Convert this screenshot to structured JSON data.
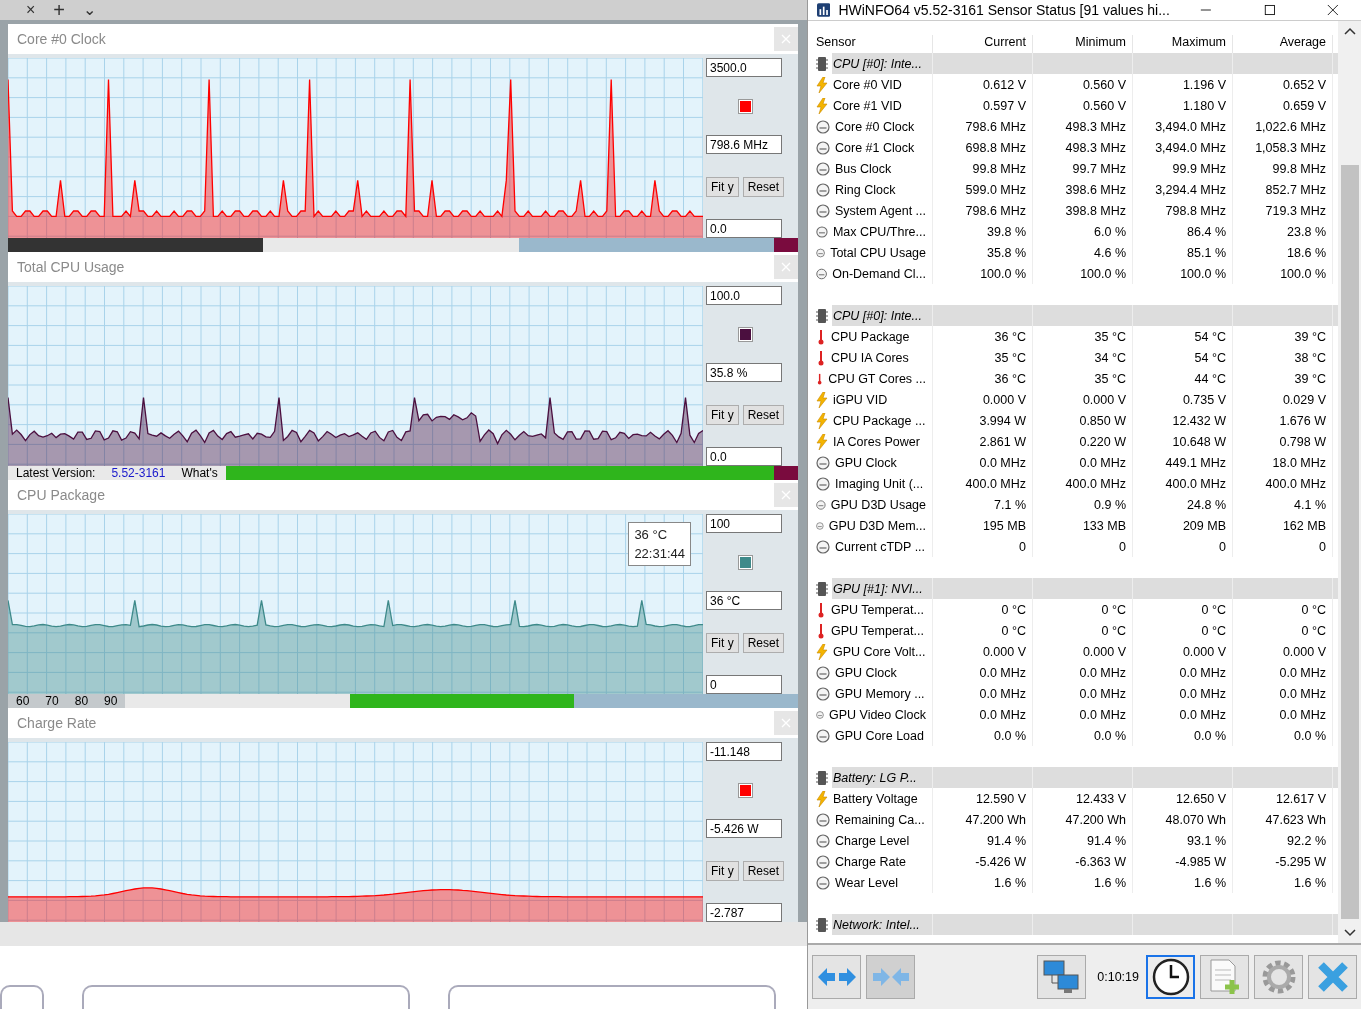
{
  "browser_tabs": {
    "close": "×",
    "new": "+",
    "more": "⌄"
  },
  "graphs": [
    {
      "title": "Core #0 Clock",
      "color": "#ff0000",
      "kind": "spikes",
      "max": "3500.0",
      "current": "798.6 MHz",
      "min": "0.0",
      "buttons": [
        "Fit y",
        "Reset"
      ]
    },
    {
      "title": "Total CPU Usage",
      "color": "#4b0f3f",
      "kind": "noise",
      "max": "100.0",
      "current": "35.8 %",
      "min": "0.0",
      "buttons": [
        "Fit y",
        "Reset"
      ]
    },
    {
      "title": "CPU Package",
      "color": "#3e8a8a",
      "kind": "flat",
      "max": "100",
      "current": "36 °C",
      "min": "0",
      "buttons": [
        "Fit y",
        "Reset"
      ],
      "tooltip": {
        "value": "36 °C",
        "time": "22:31:44"
      }
    },
    {
      "title": "Charge Rate",
      "color": "#ff0000",
      "kind": "wave",
      "max": "-11.148",
      "current": "-5.426 W",
      "min": "-2.787",
      "buttons": [
        "Fit y",
        "Reset"
      ]
    }
  ],
  "background_strips": [
    {
      "segments": [
        {
          "kind": "dark"
        },
        {
          "kind": "plain"
        },
        {
          "kind": "blue"
        },
        {
          "kind": "maroon"
        }
      ]
    },
    {
      "segments": [
        {
          "kind": "plain",
          "text": "Latest Version:"
        },
        {
          "kind": "link",
          "text": "5.52-3161"
        },
        {
          "kind": "plain",
          "text": "What's"
        },
        {
          "kind": "green"
        },
        {
          "kind": "maroon"
        }
      ]
    },
    {
      "segments": [
        {
          "kind": "tick",
          "text": "60"
        },
        {
          "kind": "tick",
          "text": "70"
        },
        {
          "kind": "tick",
          "text": "80"
        },
        {
          "kind": "tick",
          "text": "90"
        },
        {
          "kind": "plain"
        },
        {
          "kind": "green"
        },
        {
          "kind": "blue"
        }
      ]
    }
  ],
  "window": {
    "title": "HWiNFO64 v5.52-3161 Sensor Status [91 values hi..."
  },
  "table": {
    "columns": [
      "Sensor",
      "Current",
      "Minimum",
      "Maximum",
      "Average"
    ],
    "groups": [
      {
        "name": "CPU [#0]: Inte...",
        "rows": [
          {
            "kind": "volt",
            "sensor": "Core #0 VID",
            "current": "0.612 V",
            "minimum": "0.560 V",
            "maximum": "1.196 V",
            "average": "0.652 V"
          },
          {
            "kind": "volt",
            "sensor": "Core #1 VID",
            "current": "0.597 V",
            "minimum": "0.560 V",
            "maximum": "1.180 V",
            "average": "0.659 V"
          },
          {
            "kind": "clock",
            "sensor": "Core #0 Clock",
            "current": "798.6 MHz",
            "minimum": "498.3 MHz",
            "maximum": "3,494.0 MHz",
            "average": "1,022.6 MHz"
          },
          {
            "kind": "clock",
            "sensor": "Core #1 Clock",
            "current": "698.8 MHz",
            "minimum": "498.3 MHz",
            "maximum": "3,494.0 MHz",
            "average": "1,058.3 MHz"
          },
          {
            "kind": "clock",
            "sensor": "Bus Clock",
            "current": "99.8 MHz",
            "minimum": "99.7 MHz",
            "maximum": "99.9 MHz",
            "average": "99.8 MHz"
          },
          {
            "kind": "clock",
            "sensor": "Ring Clock",
            "current": "599.0 MHz",
            "minimum": "398.6 MHz",
            "maximum": "3,294.4 MHz",
            "average": "852.7 MHz"
          },
          {
            "kind": "clock",
            "sensor": "System Agent ...",
            "current": "798.6 MHz",
            "minimum": "398.8 MHz",
            "maximum": "798.8 MHz",
            "average": "719.3 MHz"
          },
          {
            "kind": "clock",
            "sensor": "Max CPU/Thre...",
            "current": "39.8 %",
            "minimum": "6.0 %",
            "maximum": "86.4 %",
            "average": "23.8 %"
          },
          {
            "kind": "clock",
            "sensor": "Total CPU Usage",
            "current": "35.8 %",
            "minimum": "4.6 %",
            "maximum": "85.1 %",
            "average": "18.6 %"
          },
          {
            "kind": "clock",
            "sensor": "On-Demand Cl...",
            "current": "100.0 %",
            "minimum": "100.0 %",
            "maximum": "100.0 %",
            "average": "100.0 %"
          }
        ]
      },
      {
        "name": "CPU [#0]: Inte...",
        "rows": [
          {
            "kind": "temp",
            "sensor": "CPU Package",
            "current": "36 °C",
            "minimum": "35 °C",
            "maximum": "54 °C",
            "average": "39 °C"
          },
          {
            "kind": "temp",
            "sensor": "CPU IA Cores",
            "current": "35 °C",
            "minimum": "34 °C",
            "maximum": "54 °C",
            "average": "38 °C"
          },
          {
            "kind": "temp",
            "sensor": "CPU GT Cores ...",
            "current": "36 °C",
            "minimum": "35 °C",
            "maximum": "44 °C",
            "average": "39 °C"
          },
          {
            "kind": "volt",
            "sensor": "iGPU VID",
            "current": "0.000 V",
            "minimum": "0.000 V",
            "maximum": "0.735 V",
            "average": "0.029 V"
          },
          {
            "kind": "volt",
            "sensor": "CPU Package ...",
            "current": "3.994 W",
            "minimum": "0.850 W",
            "maximum": "12.432 W",
            "average": "1.676 W"
          },
          {
            "kind": "volt",
            "sensor": "IA Cores Power",
            "current": "2.861 W",
            "minimum": "0.220 W",
            "maximum": "10.648 W",
            "average": "0.798 W"
          },
          {
            "kind": "clock",
            "sensor": "GPU Clock",
            "current": "0.0 MHz",
            "minimum": "0.0 MHz",
            "maximum": "449.1 MHz",
            "average": "18.0 MHz"
          },
          {
            "kind": "clock",
            "sensor": "Imaging Unit (...",
            "current": "400.0 MHz",
            "minimum": "400.0 MHz",
            "maximum": "400.0 MHz",
            "average": "400.0 MHz"
          },
          {
            "kind": "clock",
            "sensor": "GPU D3D Usage",
            "current": "7.1 %",
            "minimum": "0.9 %",
            "maximum": "24.8 %",
            "average": "4.1 %"
          },
          {
            "kind": "clock",
            "sensor": "GPU D3D Mem...",
            "current": "195 MB",
            "minimum": "133 MB",
            "maximum": "209 MB",
            "average": "162 MB"
          },
          {
            "kind": "clock",
            "sensor": "Current cTDP ...",
            "current": "0",
            "minimum": "0",
            "maximum": "0",
            "average": "0"
          }
        ]
      },
      {
        "name": "GPU [#1]: NVI...",
        "rows": [
          {
            "kind": "temp",
            "sensor": "GPU Temperat...",
            "current": "0 °C",
            "minimum": "0 °C",
            "maximum": "0 °C",
            "average": "0 °C"
          },
          {
            "kind": "temp",
            "sensor": "GPU Temperat...",
            "current": "0 °C",
            "minimum": "0 °C",
            "maximum": "0 °C",
            "average": "0 °C"
          },
          {
            "kind": "volt",
            "sensor": "GPU Core Volt...",
            "current": "0.000 V",
            "minimum": "0.000 V",
            "maximum": "0.000 V",
            "average": "0.000 V"
          },
          {
            "kind": "clock",
            "sensor": "GPU Clock",
            "current": "0.0 MHz",
            "minimum": "0.0 MHz",
            "maximum": "0.0 MHz",
            "average": "0.0 MHz"
          },
          {
            "kind": "clock",
            "sensor": "GPU Memory ...",
            "current": "0.0 MHz",
            "minimum": "0.0 MHz",
            "maximum": "0.0 MHz",
            "average": "0.0 MHz"
          },
          {
            "kind": "clock",
            "sensor": "GPU Video Clock",
            "current": "0.0 MHz",
            "minimum": "0.0 MHz",
            "maximum": "0.0 MHz",
            "average": "0.0 MHz"
          },
          {
            "kind": "clock",
            "sensor": "GPU Core Load",
            "current": "0.0 %",
            "minimum": "0.0 %",
            "maximum": "0.0 %",
            "average": "0.0 %"
          }
        ]
      },
      {
        "name": "Battery: LG P...",
        "rows": [
          {
            "kind": "volt",
            "sensor": "Battery Voltage",
            "current": "12.590 V",
            "minimum": "12.433 V",
            "maximum": "12.650 V",
            "average": "12.617 V"
          },
          {
            "kind": "clock",
            "sensor": "Remaining Ca...",
            "current": "47.200 Wh",
            "minimum": "47.200 Wh",
            "maximum": "48.070 Wh",
            "average": "47.623 Wh"
          },
          {
            "kind": "clock",
            "sensor": "Charge Level",
            "current": "91.4 %",
            "minimum": "91.4 %",
            "maximum": "93.1 %",
            "average": "92.2 %"
          },
          {
            "kind": "clock",
            "sensor": "Charge Rate",
            "current": "-5.426 W",
            "minimum": "-6.363 W",
            "maximum": "-4.985 W",
            "average": "-5.295 W"
          },
          {
            "kind": "clock",
            "sensor": "Wear Level",
            "current": "1.6 %",
            "minimum": "1.6 %",
            "maximum": "1.6 %",
            "average": "1.6 %"
          }
        ]
      },
      {
        "name": "Network: Intel..."
      }
    ]
  },
  "toolbar": {
    "left": [
      {
        "kind": "swap",
        "selected": false
      },
      {
        "kind": "merge",
        "selected": false
      }
    ],
    "right": [
      {
        "kind": "network",
        "selected": false
      },
      {
        "kind": "timer",
        "text": "0:10:19"
      },
      {
        "kind": "clock",
        "selected": true
      },
      {
        "kind": "report",
        "selected": false
      },
      {
        "kind": "settings",
        "selected": false
      },
      {
        "kind": "close",
        "selected": false
      }
    ]
  }
}
